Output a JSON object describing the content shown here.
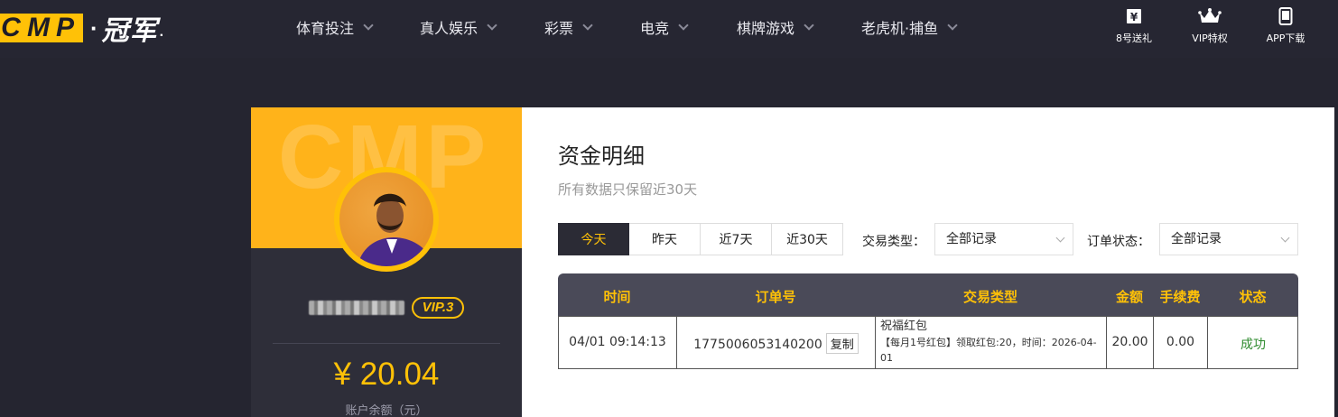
{
  "logo": {
    "letters": [
      "C",
      "M",
      "P"
    ],
    "dot": "·",
    "cn": "冠军",
    "tail": "."
  },
  "nav": {
    "items": [
      {
        "label": "体育投注"
      },
      {
        "label": "真人娱乐"
      },
      {
        "label": "彩票"
      },
      {
        "label": "电竞"
      },
      {
        "label": "棋牌游戏"
      },
      {
        "label": "老虎机·捕鱼"
      }
    ]
  },
  "right_nav": [
    {
      "label": "8号送礼",
      "icon": "gift-ticket-icon"
    },
    {
      "label": "VIP特权",
      "icon": "crown-icon"
    },
    {
      "label": "APP下载",
      "icon": "phone-icon"
    }
  ],
  "profile": {
    "ghost_text": "CMP",
    "vip_label": "VIP.3",
    "balance": "¥ 20.04",
    "balance_label": "账户余额（元）"
  },
  "page": {
    "title": "资金明细",
    "subtitle": "所有数据只保留近30天"
  },
  "tabs": [
    {
      "label": "今天",
      "active": true
    },
    {
      "label": "昨天",
      "active": false
    },
    {
      "label": "近7天",
      "active": false
    },
    {
      "label": "近30天",
      "active": false
    }
  ],
  "filters": {
    "type_label": "交易类型：",
    "type_value": "全部记录",
    "status_label": "订单状态：",
    "status_value": "全部记录"
  },
  "table": {
    "headers": [
      "时间",
      "订单号",
      "交易类型",
      "金额",
      "手续费",
      "状态"
    ],
    "rows": [
      {
        "time": "04/01 09:14:13",
        "order_no": "1775006053140200",
        "copy_label": "复制",
        "type_title": "祝福红包",
        "type_detail": "【每月1号红包】领取红包:20，时间：2026-04-01",
        "amount": "20.00",
        "fee": "0.00",
        "status": "成功"
      }
    ]
  },
  "colors": {
    "accent": "#ffc107",
    "dark": "#262632",
    "success": "#2e8b2e"
  }
}
